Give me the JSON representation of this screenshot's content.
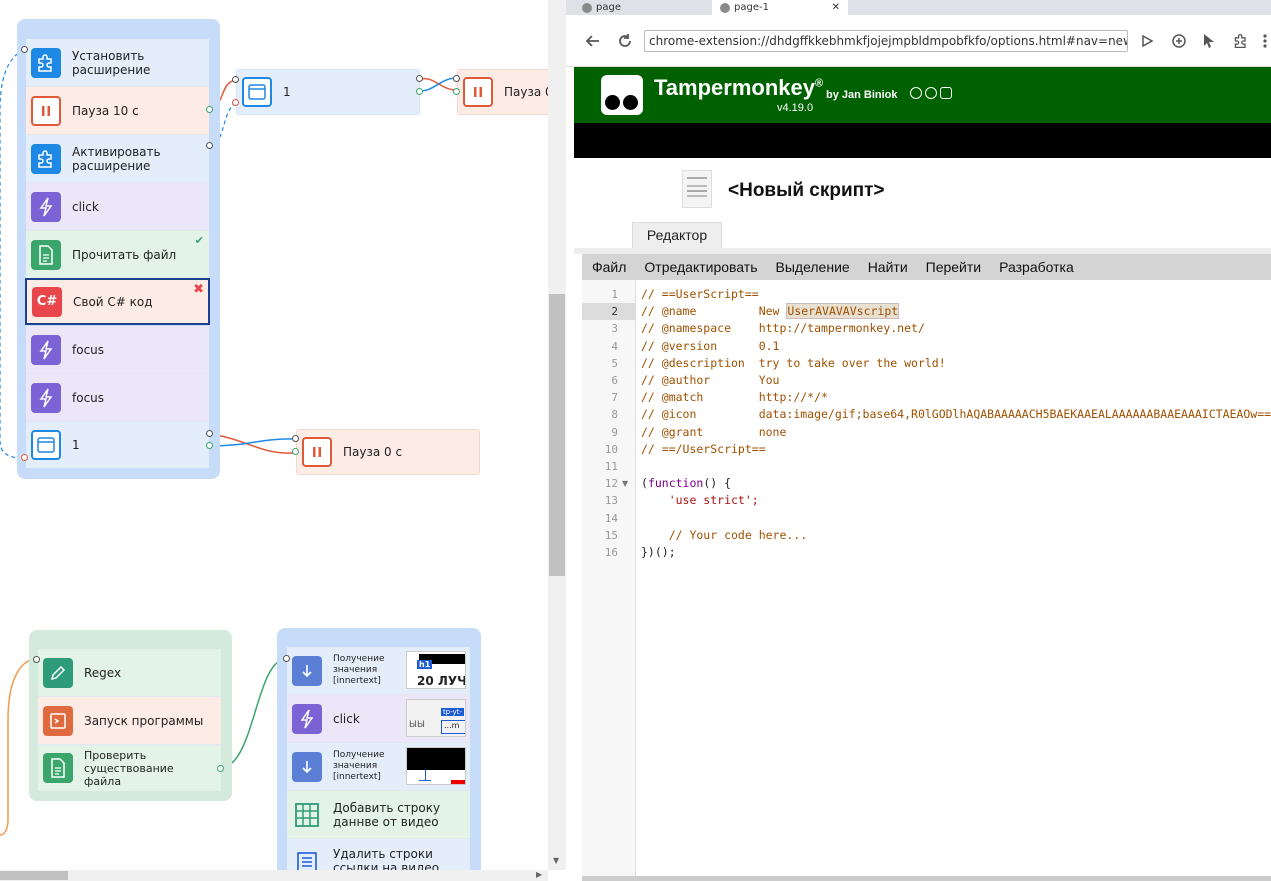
{
  "canvas": {
    "group1": [
      {
        "label": "Установить расширение",
        "type": "extension"
      },
      {
        "label": "Пауза 10 с",
        "type": "pause"
      },
      {
        "label": "Активировать расширение",
        "type": "extension"
      },
      {
        "label": "click",
        "type": "action"
      },
      {
        "label": "Прочитать файл",
        "type": "file",
        "status": "success"
      },
      {
        "label": "Свой C# код",
        "type": "csharp",
        "status": "error"
      },
      {
        "label": "focus",
        "type": "action"
      },
      {
        "label": "focus",
        "type": "action"
      },
      {
        "label": "1",
        "type": "window"
      }
    ],
    "icon_text_csharp": "C#",
    "node_window_top": "1",
    "node_pause_top": "Пауза 0",
    "node_pause_bottom": "Пауза 0 с",
    "group2": [
      {
        "label": "Regex"
      },
      {
        "label": "Запуск программы"
      },
      {
        "label": "Проверить существование файла"
      }
    ],
    "group3": [
      {
        "label": "Получение значения [innertext]"
      },
      {
        "label": "click"
      },
      {
        "label": "Получение значения [innertext]"
      },
      {
        "label": "Добавить строку даннве от видео"
      },
      {
        "label": "Удалить строки ссылки на видео"
      }
    ],
    "thumb1_tag": "h1",
    "thumb1_text": "20 ЛУЧІ",
    "thumb2_tag": "tp-yt-",
    "thumb2_text": "ЫЫ",
    "thumb2_sub": "...m",
    "colors": {
      "blue": "#1e88e5",
      "red": "#e05a3a",
      "purple": "#7b63d6",
      "green": "#3aa66b"
    }
  },
  "browser": {
    "tabs": [
      {
        "label": "page"
      },
      {
        "label": "page-1"
      }
    ],
    "address": "chrome-extension://dhdgffkkebhmkfjojejmpbldmpobfkfo/options.html#nav=new-us",
    "tm_title": "Tampermonkey",
    "tm_reg": "®",
    "tm_by": "by Jan Biniok",
    "tm_version": "v4.19.0",
    "script_title": "<Новый скрипт>",
    "editor_tab": "Редактор",
    "menu": [
      "Файл",
      "Отредактировать",
      "Выделение",
      "Найти",
      "Перейти",
      "Разработка"
    ],
    "code_lines": [
      "// ==UserScript==",
      "// @name         New UserAVAVAVscript",
      "// @namespace    http://tampermonkey.net/",
      "// @version      0.1",
      "// @description  try to take over the world!",
      "// @author       You",
      "// @match        http://*/*",
      "// @icon         data:image/gif;base64,R0lGODlhAQABAAAAACH5BAEKAAEALAAAAAABAAEAAAICTAEAOw==",
      "// @grant        none",
      "// ==/UserScript==",
      "",
      "(function() {",
      "    'use strict';",
      "",
      "    // Your code here...",
      "})();"
    ],
    "line_numbers": [
      "1",
      "2",
      "3",
      "4",
      "5",
      "6",
      "7",
      "8",
      "9",
      "10",
      "11",
      "12",
      "13",
      "14",
      "15",
      "16"
    ],
    "active_line": 2
  }
}
